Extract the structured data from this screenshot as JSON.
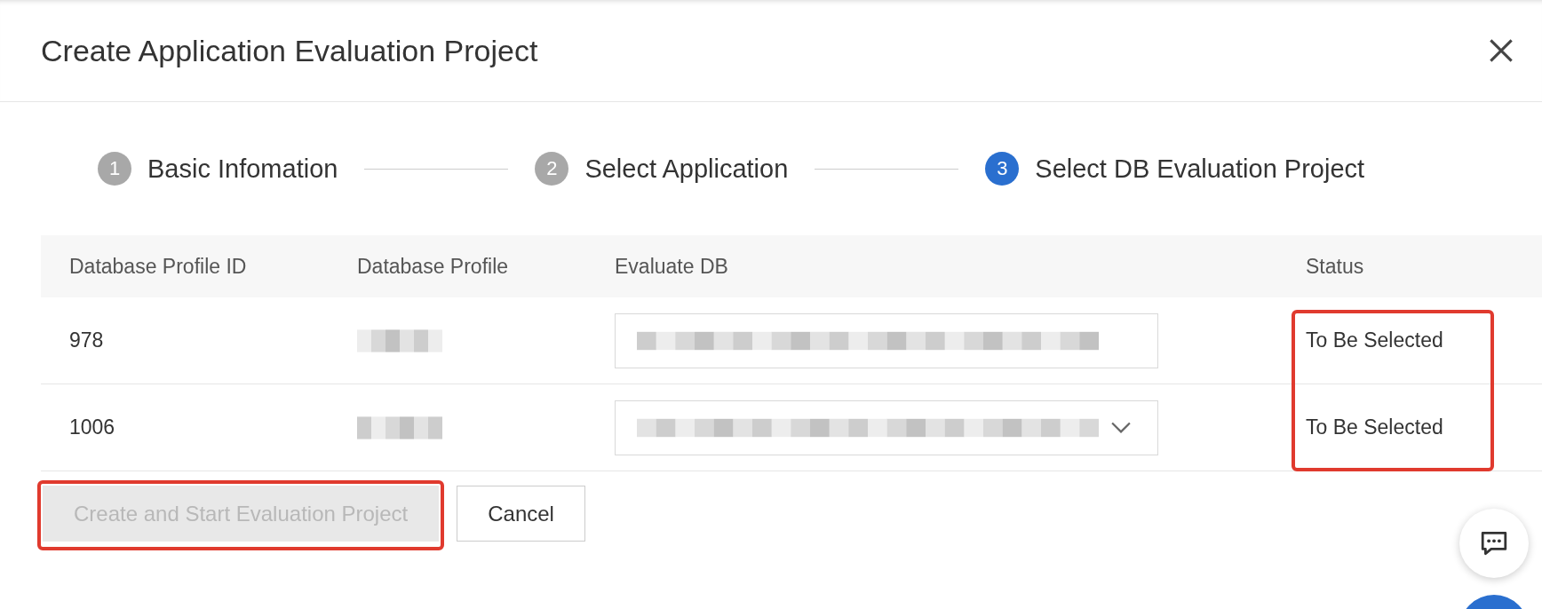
{
  "dialog": {
    "title": "Create Application Evaluation Project"
  },
  "steps": [
    {
      "number": "1",
      "label": "Basic Infomation",
      "current": false
    },
    {
      "number": "2",
      "label": "Select Application",
      "current": false
    },
    {
      "number": "3",
      "label": "Select DB Evaluation Project",
      "current": true
    }
  ],
  "table": {
    "columns": [
      "Database Profile ID",
      "Database Profile",
      "Evaluate DB",
      "Status"
    ],
    "status_highlighted": true,
    "rows": [
      {
        "id": "978",
        "status": "To Be Selected",
        "show_caret": false
      },
      {
        "id": "1006",
        "status": "To Be Selected",
        "show_caret": true
      }
    ]
  },
  "buttons": [
    {
      "label": "Create and Start Evaluation Project",
      "kind": "primary",
      "disabled": true,
      "highlighted": true
    },
    {
      "label": "Cancel",
      "kind": "secondary",
      "disabled": false,
      "highlighted": false
    }
  ]
}
